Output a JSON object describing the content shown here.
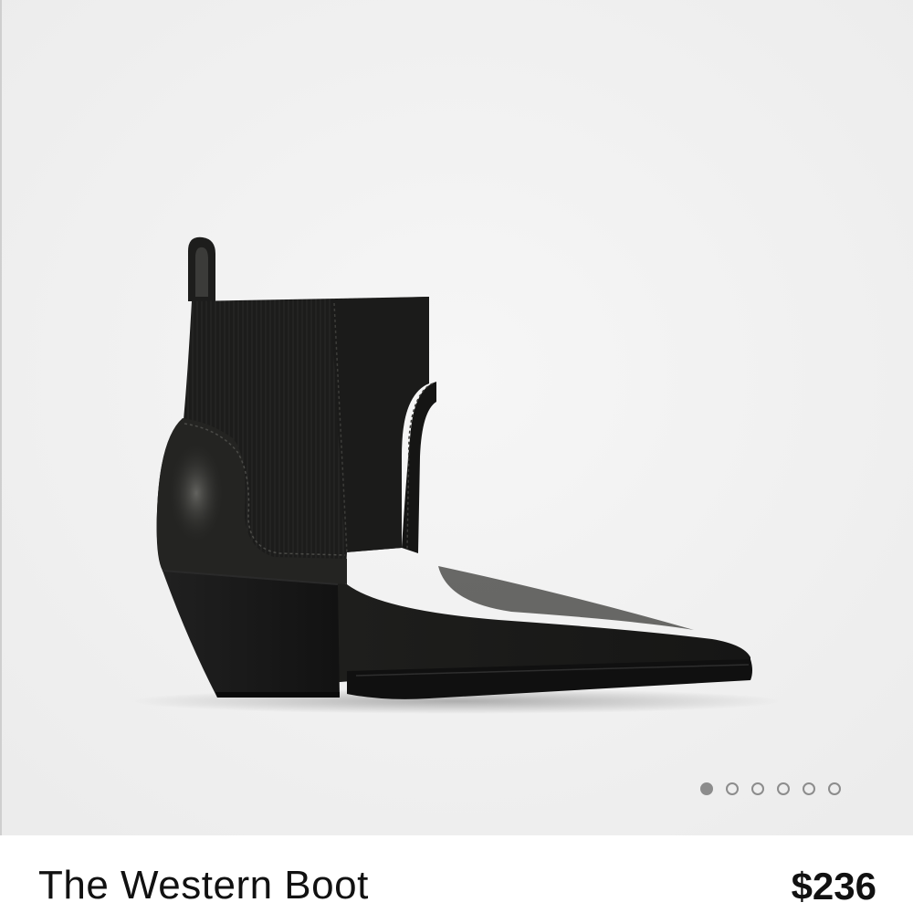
{
  "product": {
    "name": "The Western Boot",
    "price": "$236",
    "image_subject": "black-leather-western-ankle-boot"
  },
  "carousel": {
    "total_images": 6,
    "active_index": 0
  },
  "colors": {
    "background": "#f2f2f2",
    "dot": "#8c8c8c",
    "text": "#111111"
  }
}
